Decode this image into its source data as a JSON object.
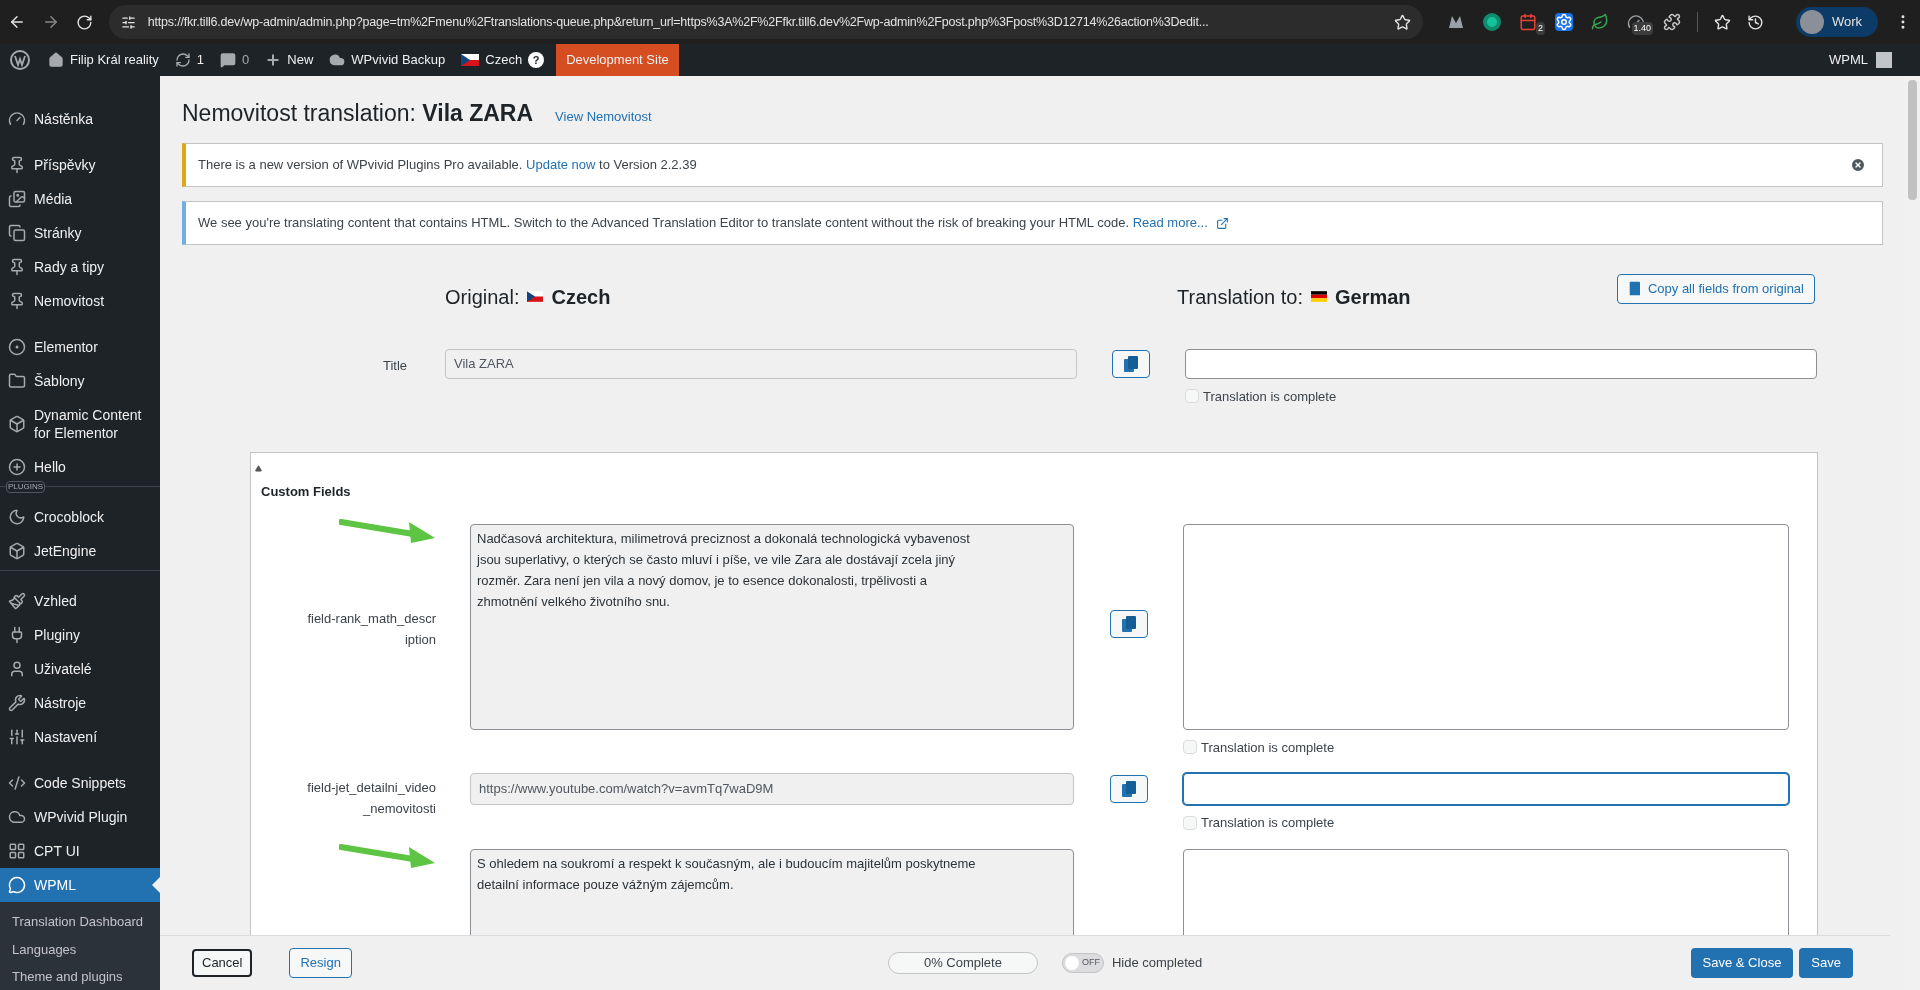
{
  "browser": {
    "url": "https://fkr.till6.dev/wp-admin/admin.php?page=tm%2Fmenu%2Ftranslations-queue.php&return_url=https%3A%2F%2Ffkr.till6.dev%2Fwp-admin%2Fpost.php%3Fpost%3D12714%26action%3Dedit...",
    "extensions": [
      {
        "kind": "m"
      },
      {
        "kind": "g"
      },
      {
        "kind": "calendar",
        "badge": "2"
      },
      {
        "kind": "gear"
      },
      {
        "kind": "leaf"
      },
      {
        "kind": "meter",
        "badge": "1.40"
      },
      {
        "kind": "puzzle"
      }
    ],
    "profile": "Work"
  },
  "admin_bar": {
    "items": [
      {
        "kind": "home",
        "label": "Filip Král reality"
      },
      {
        "kind": "updates",
        "label": "1"
      },
      {
        "kind": "comments",
        "label": "0"
      },
      {
        "kind": "new",
        "label": "New"
      },
      {
        "kind": "cloud",
        "label": "WPvivid Backup"
      },
      {
        "kind": "language",
        "label": "Czech",
        "badge": "?"
      },
      {
        "kind": "env",
        "label": "Development Site"
      }
    ],
    "user": "WPML"
  },
  "sidebar": {
    "items": [
      {
        "kind": "dashboard",
        "label": "Nástěnka",
        "selected": false
      },
      {
        "kind": "gap"
      },
      {
        "kind": "pin",
        "label": "Příspěvky",
        "selected": false
      },
      {
        "kind": "media",
        "label": "Média",
        "selected": false
      },
      {
        "kind": "pages",
        "label": "Stránky",
        "selected": false
      },
      {
        "kind": "pin",
        "label": "Rady a tipy",
        "selected": false
      },
      {
        "kind": "pin",
        "label": "Nemovitost",
        "selected": false
      },
      {
        "kind": "gap"
      },
      {
        "kind": "elementor",
        "label": "Elementor",
        "selected": false
      },
      {
        "kind": "folder",
        "label": "Šablony",
        "selected": false
      },
      {
        "kind": "dynamic",
        "label": "Dynamic Content for Elementor",
        "selected": false
      },
      {
        "kind": "plus",
        "label": "Hello",
        "selected": false
      },
      {
        "kind": "separator",
        "label": "PLUGINS"
      },
      {
        "kind": "moon",
        "label": "Crocoblock",
        "selected": false
      },
      {
        "kind": "jet",
        "label": "JetEngine",
        "selected": false
      },
      {
        "kind": "separator"
      },
      {
        "kind": "brush",
        "label": "Vzhled",
        "selected": false
      },
      {
        "kind": "plug",
        "label": "Pluginy",
        "selected": false
      },
      {
        "kind": "user",
        "label": "Uživatelé",
        "selected": false
      },
      {
        "kind": "wrench",
        "label": "Nástroje",
        "selected": false
      },
      {
        "kind": "sliders",
        "label": "Nastavení",
        "selected": false
      },
      {
        "kind": "gap"
      },
      {
        "kind": "code",
        "label": "Code Snippets",
        "selected": false
      },
      {
        "kind": "cloud",
        "label": "WPvivid Plugin",
        "selected": false
      },
      {
        "kind": "grid",
        "label": "CPT UI",
        "selected": false
      },
      {
        "kind": "wpml",
        "label": "WPML",
        "selected": true
      }
    ],
    "submenu": [
      "Translation Dashboard",
      "Languages",
      "Theme and plugins"
    ]
  },
  "page": {
    "title_prefix": "Nemovitost translation:",
    "title_name": "Vila ZARA",
    "view_link": "View Nemovitost"
  },
  "notices": [
    {
      "kind": "warning",
      "text": "There is a new version of WPvivid Plugins Pro available.",
      "link": "Update now",
      "after": "to Version 2.2.39",
      "dismissible": true
    },
    {
      "kind": "info",
      "text": "We see you're translating content that contains HTML. Switch to the Advanced Translation Editor to translate content without the risk of breaking your HTML code.",
      "link": "Read more...",
      "external": true
    }
  ],
  "editor": {
    "original_label": "Original:",
    "original_language": "Czech",
    "translation_label": "Translation to:",
    "translation_language": "German",
    "copy_all": "Copy all fields from original",
    "title_field": {
      "label": "Title",
      "original": "Vila ZARA",
      "complete_label": "Translation is complete",
      "complete": false
    },
    "custom_fields": {
      "title": "Custom Fields",
      "expanded": true,
      "fields": [
        {
          "kind": "textarea",
          "label": "field-rank_math_description",
          "original": "Nadčasová architektura, milimetrová preciznost a dokonalá technologická vybavenost jsou superlativy, o kterých se často mluví i píše, ve vile Zara ale dostávají zcela jiný rozměr. Zara není jen vila a nový domov, je to esence dokonalosti, trpělivosti a zhmotnění velkého životního snu.",
          "complete_label": "Translation is complete",
          "complete": false,
          "focused": false,
          "annotated": true
        },
        {
          "kind": "input",
          "label": "field-jet_detailni_video_nemovitosti",
          "original": "https://www.youtube.com/watch?v=avmTq7waD9M",
          "complete_label": "Translation is complete",
          "complete": false,
          "focused": true
        },
        {
          "kind": "textarea",
          "original": "S ohledem na soukromí a respekt k současným, ale i budoucím majitelům poskytneme detailní informace pouze vážným zájemcům.",
          "focused": false,
          "annotated": true
        }
      ]
    }
  },
  "footer": {
    "cancel": "Cancel",
    "resign": "Resign",
    "progress": {
      "label": "0% Complete",
      "level": 0
    },
    "toggle": {
      "label": "OFF",
      "on": false
    },
    "hide_label": "Hide completed",
    "save_close": "Save & Close",
    "save": "Save"
  }
}
